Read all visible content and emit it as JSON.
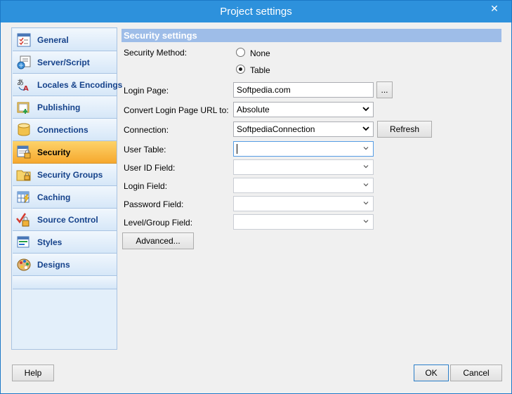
{
  "window": {
    "title": "Project settings",
    "close_symbol": "✕"
  },
  "sidebar": {
    "items": [
      {
        "label": "General",
        "icon": "general-icon"
      },
      {
        "label": "Server/Script",
        "icon": "server-script-icon"
      },
      {
        "label": "Locales & Encodings",
        "icon": "locales-icon"
      },
      {
        "label": "Publishing",
        "icon": "publishing-icon"
      },
      {
        "label": "Connections",
        "icon": "connections-icon"
      },
      {
        "label": "Security",
        "icon": "security-icon",
        "selected": true
      },
      {
        "label": "Security Groups",
        "icon": "security-groups-icon"
      },
      {
        "label": "Caching",
        "icon": "caching-icon"
      },
      {
        "label": "Source Control",
        "icon": "source-control-icon"
      },
      {
        "label": "Styles",
        "icon": "styles-icon"
      },
      {
        "label": "Designs",
        "icon": "designs-icon"
      }
    ]
  },
  "security": {
    "header": "Security settings",
    "method_label": "Security Method:",
    "method_options": [
      "None",
      "Table"
    ],
    "method_selected": "Table",
    "login_page_label": "Login Page:",
    "login_page_value": "Softpedia.com",
    "browse_label": "...",
    "convert_label": "Convert Login Page URL to:",
    "convert_value": "Absolute",
    "connection_label": "Connection:",
    "connection_value": "SoftpediaConnection",
    "refresh_label": "Refresh",
    "user_table_label": "User Table:",
    "user_table_value": "",
    "user_id_label": "User ID Field:",
    "user_id_value": "",
    "login_field_label": "Login Field:",
    "login_field_value": "",
    "password_label": "Password Field:",
    "password_value": "",
    "level_label": "Level/Group Field:",
    "level_value": "",
    "advanced_label": "Advanced..."
  },
  "footer": {
    "help_label": "Help",
    "ok_label": "OK",
    "cancel_label": "Cancel"
  },
  "colors": {
    "title_bar": "#2d91dc",
    "selected_item": "#f8b63c",
    "section_header": "#9ebde8"
  }
}
